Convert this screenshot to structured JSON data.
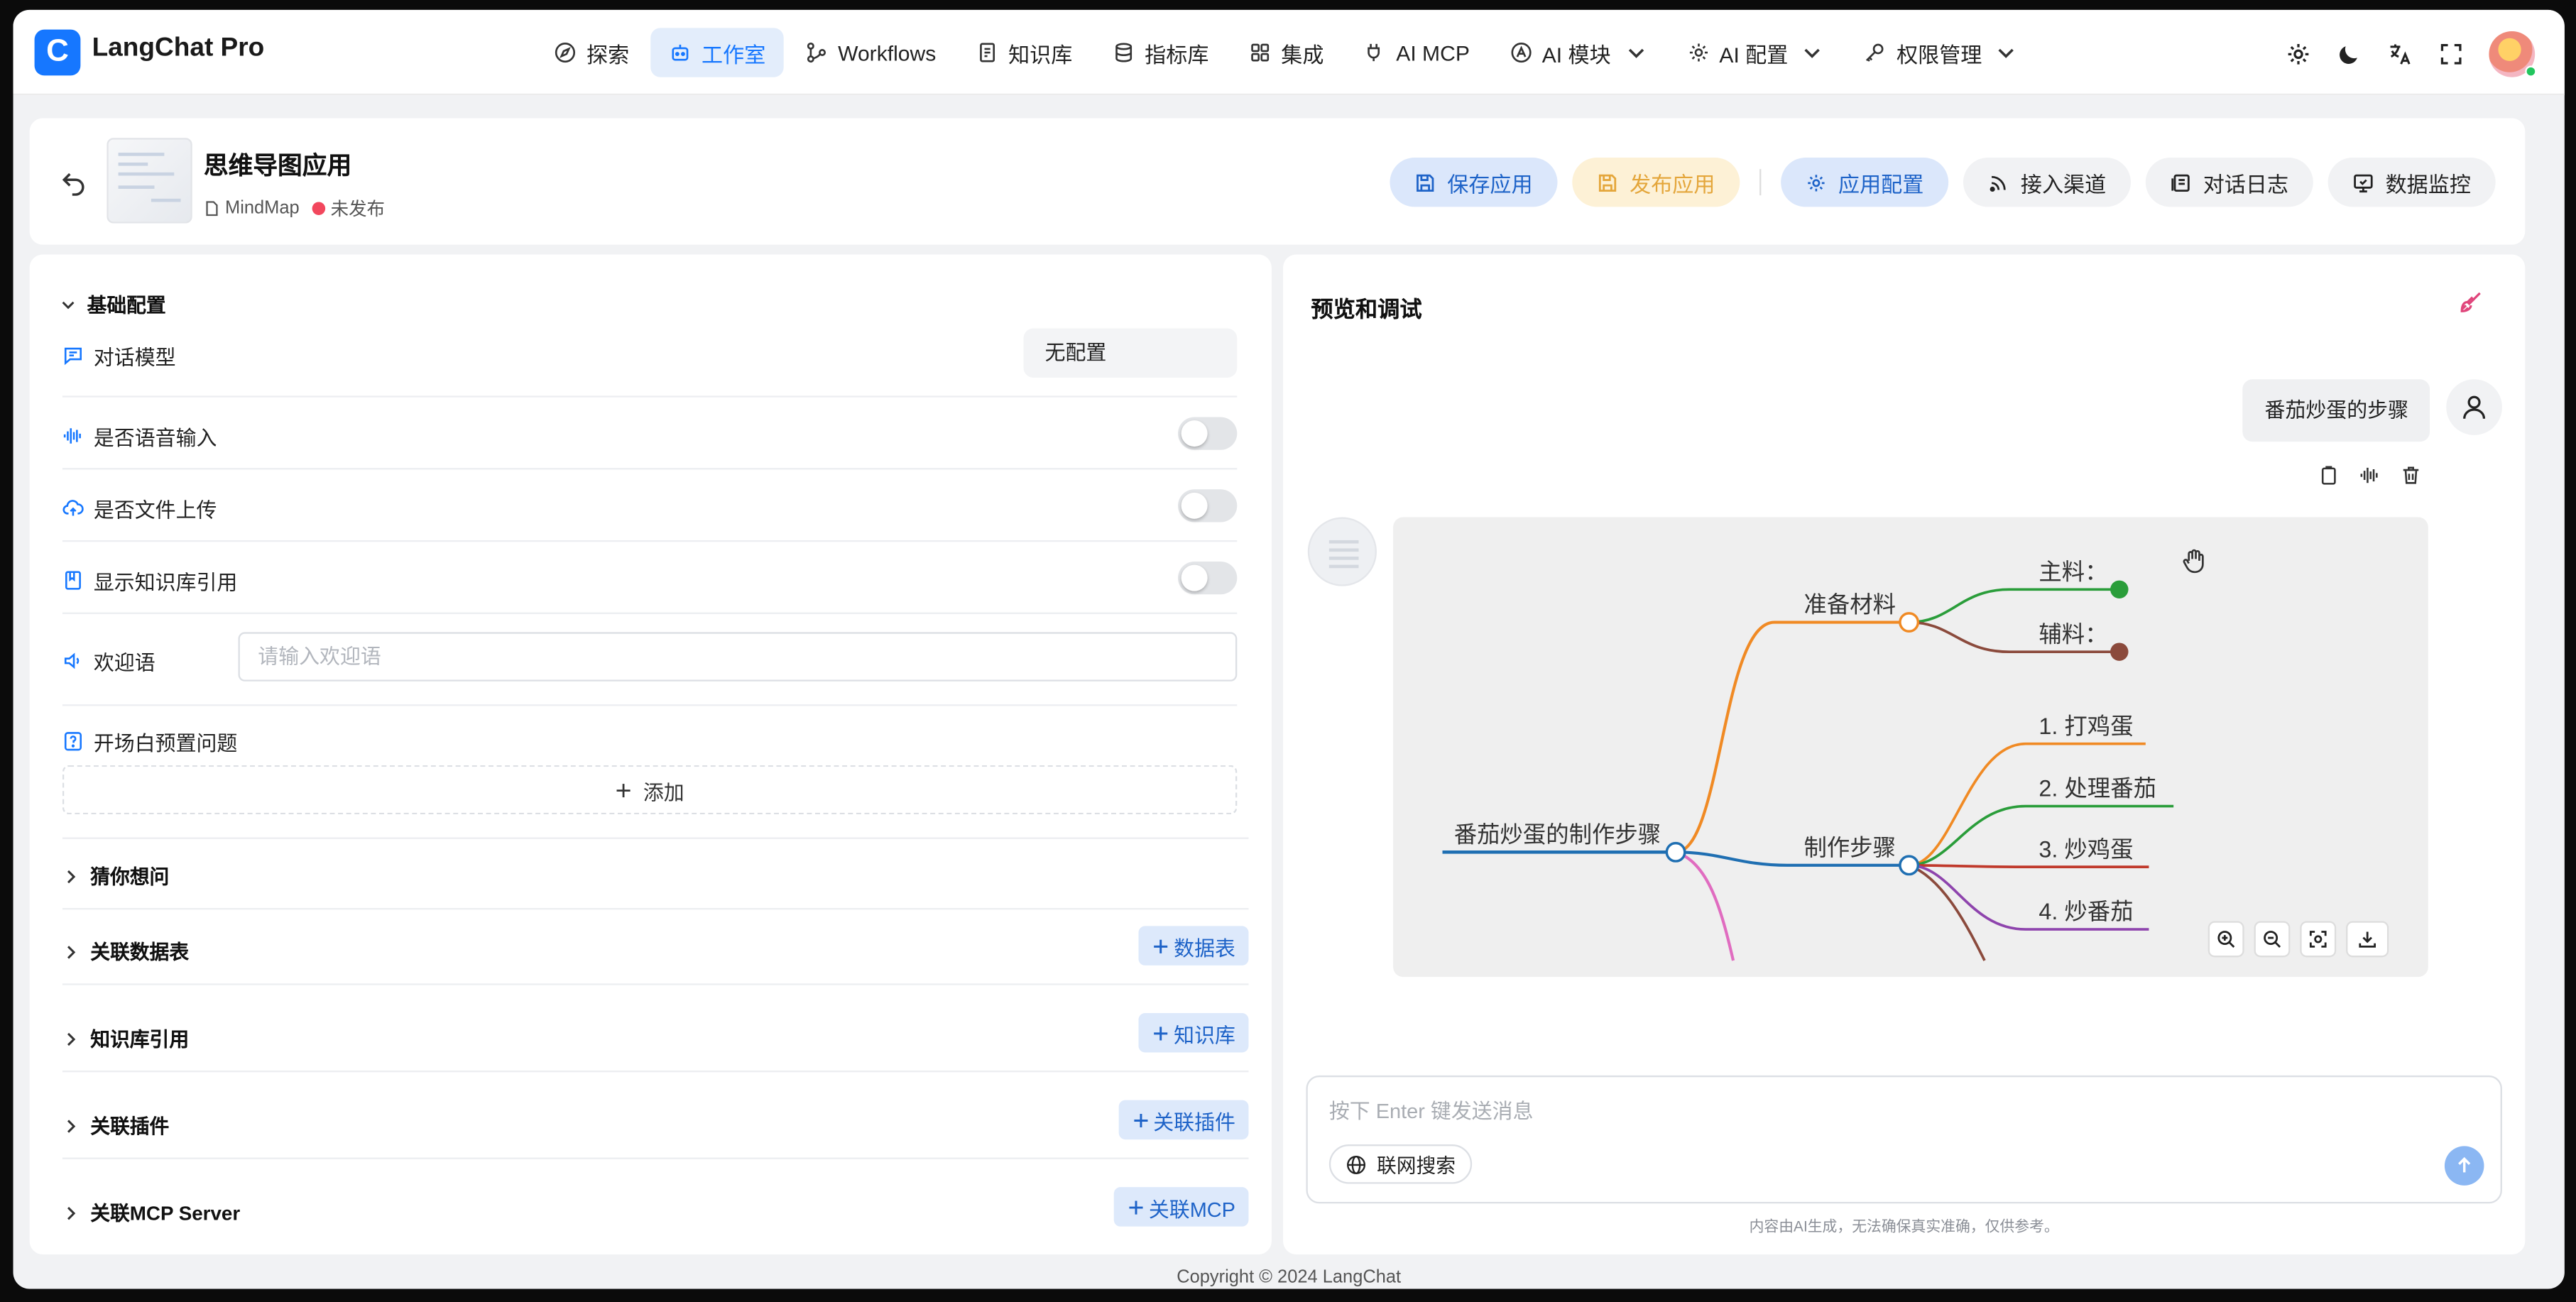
{
  "app": {
    "logo_letter": "C",
    "brand": "LangChat Pro"
  },
  "nav": [
    {
      "label": "探索",
      "icon": "compass-icon"
    },
    {
      "label": "工作室",
      "icon": "robot-icon",
      "active": true
    },
    {
      "label": "Workflows",
      "icon": "workflow-icon"
    },
    {
      "label": "知识库",
      "icon": "book-icon"
    },
    {
      "label": "指标库",
      "icon": "database-icon"
    },
    {
      "label": "集成",
      "icon": "puzzle-icon"
    },
    {
      "label": "AI MCP",
      "icon": "plug-icon"
    },
    {
      "label": "AI 模块",
      "icon": "ai-module-icon",
      "dropdown": true
    },
    {
      "label": "AI 配置",
      "icon": "gear-icon",
      "dropdown": true
    },
    {
      "label": "权限管理",
      "icon": "key-icon",
      "dropdown": true
    }
  ],
  "topbar_icons": [
    "settings-icon",
    "moon-icon",
    "translate-icon",
    "fullscreen-icon"
  ],
  "header": {
    "title": "思维导图应用",
    "type_label": "MindMap",
    "status": "未发布",
    "buttons": {
      "save": "保存应用",
      "publish": "发布应用",
      "config": "应用配置",
      "channel": "接入渠道",
      "logs": "对话日志",
      "monitor": "数据监控"
    }
  },
  "basic": {
    "section_title": "基础配置",
    "model_label": "对话模型",
    "model_value": "无配置",
    "voice_label": "是否语音输入",
    "voice_on": false,
    "upload_label": "是否文件上传",
    "upload_on": false,
    "kb_ref_label": "显示知识库引用",
    "kb_ref_on": false,
    "welcome_label": "欢迎语",
    "welcome_placeholder": "请输入欢迎语",
    "preset_label": "开场白预置问题",
    "add_label": "添加"
  },
  "collapsibles": [
    {
      "title": "猜你想问",
      "button": ""
    },
    {
      "title": "关联数据表",
      "button": "数据表"
    },
    {
      "title": "知识库引用",
      "button": "知识库"
    },
    {
      "title": "关联插件",
      "button": "关联插件"
    },
    {
      "title": "关联MCP Server",
      "button": "关联MCP"
    }
  ],
  "preview": {
    "title": "预览和调试",
    "user_message": "番茄炒蛋的步骤",
    "input_placeholder": "按下 Enter 键发送消息",
    "web_search": "联网搜索",
    "disclaimer": "内容由AI生成，无法确保真实准确，仅供参考。"
  },
  "mindmap": {
    "root": "番茄炒蛋的制作步骤",
    "branches": [
      {
        "label": "准备材料",
        "color": "#f08a24",
        "children": [
          {
            "label": "主料：",
            "color": "#2a9d3a"
          },
          {
            "label": "辅料：",
            "color": "#8b4a3c"
          }
        ]
      },
      {
        "label": "制作步骤",
        "color": "#1f6fb2",
        "children": [
          {
            "label": "1. 打鸡蛋",
            "color": "#f08a24"
          },
          {
            "label": "2. 处理番茄",
            "color": "#2a9d3a"
          },
          {
            "label": "3. 炒鸡蛋",
            "color": "#c0392b"
          },
          {
            "label": "4. 炒番茄",
            "color": "#8e44ad"
          }
        ]
      }
    ]
  },
  "colors": {
    "accent": "#1677ff",
    "status_red": "#f2475d",
    "primary_bg": "#dbe7fb",
    "warn_bg": "#fdf1d6"
  },
  "footer": {
    "copyright": "Copyright © 2024 LangChat"
  }
}
